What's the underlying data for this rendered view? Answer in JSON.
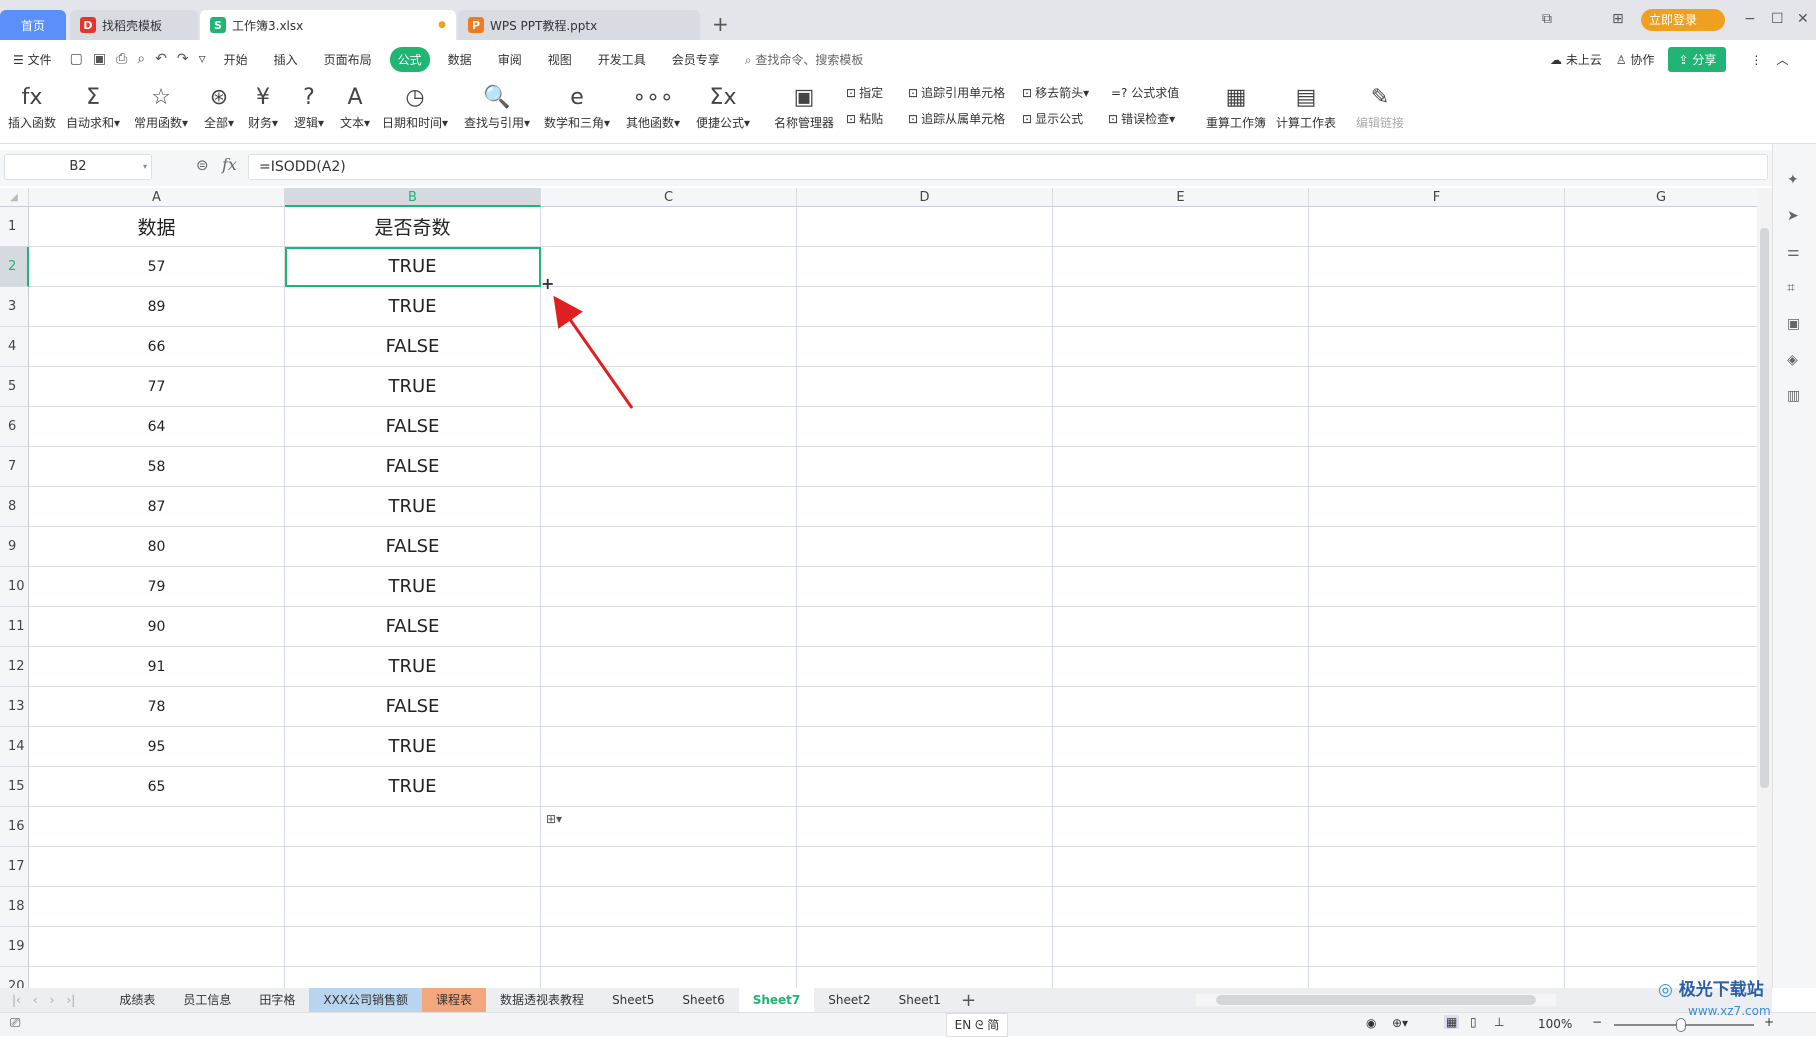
{
  "tabs": [
    {
      "label": "首页",
      "active": false,
      "color": "#5b8ff9"
    },
    {
      "label": "找稻壳模板",
      "icon": "docer-icon",
      "color": "#e8352c"
    },
    {
      "label": "工作簿3.xlsx",
      "icon": "spreadsheet-icon",
      "color": "#21b573",
      "active": true
    },
    {
      "label": "WPS PPT教程.pptx",
      "icon": "presentation-icon",
      "color": "#f07a1f"
    }
  ],
  "login": "立即登录",
  "menu": {
    "file": "文件",
    "items": [
      "开始",
      "插入",
      "页面布局",
      "公式",
      "数据",
      "审阅",
      "视图",
      "开发工具",
      "会员专享"
    ],
    "active": "公式",
    "search": "查找命令、搜索模板",
    "cloud": "未上云",
    "collab": "协作",
    "share": "分享"
  },
  "ribbon": {
    "big": [
      [
        "fx",
        "插入函数"
      ],
      [
        "Σ",
        "自动求和▾"
      ],
      [
        "☆",
        "常用函数▾"
      ],
      [
        "⊛",
        "全部▾"
      ],
      [
        "¥",
        "财务▾"
      ],
      [
        "?",
        "逻辑▾"
      ],
      [
        "A",
        "文本▾"
      ],
      [
        "◷",
        "日期和时间▾"
      ],
      [
        "🔍",
        "查找与引用▾"
      ],
      [
        "e",
        "数学和三角▾"
      ],
      [
        "∘∘∘",
        "其他函数▾"
      ],
      [
        "Σx",
        "便捷公式▾"
      ],
      [
        "▣",
        "名称管理器"
      ]
    ],
    "small": [
      "指定",
      "粘贴",
      "追踪引用单元格",
      "追踪从属单元格",
      "移去箭头▾",
      "显示公式",
      "=? 公式求值",
      "错误检查▾"
    ],
    "big2": [
      [
        "▦",
        "重算工作簿"
      ],
      [
        "▤",
        "计算工作表"
      ],
      [
        "✎",
        "编辑链接"
      ]
    ]
  },
  "formula": {
    "cell": "B2",
    "fx": "fx",
    "value": "=ISODD(A2)"
  },
  "columns": [
    "A",
    "B",
    "C",
    "D",
    "E",
    "F",
    "G"
  ],
  "rows": [
    [
      "数据",
      "是否奇数"
    ],
    [
      "57",
      "TRUE"
    ],
    [
      "89",
      "TRUE"
    ],
    [
      "66",
      "FALSE"
    ],
    [
      "77",
      "TRUE"
    ],
    [
      "64",
      "FALSE"
    ],
    [
      "58",
      "FALSE"
    ],
    [
      "87",
      "TRUE"
    ],
    [
      "80",
      "FALSE"
    ],
    [
      "79",
      "TRUE"
    ],
    [
      "90",
      "FALSE"
    ],
    [
      "91",
      "TRUE"
    ],
    [
      "78",
      "FALSE"
    ],
    [
      "95",
      "TRUE"
    ],
    [
      "65",
      "TRUE"
    ],
    [
      "",
      ""
    ],
    [
      "",
      ""
    ],
    [
      "",
      ""
    ],
    [
      "",
      ""
    ],
    [
      "",
      ""
    ]
  ],
  "sheets": [
    {
      "name": "成绩表"
    },
    {
      "name": "员工信息"
    },
    {
      "name": "田字格"
    },
    {
      "name": "XXX公司销售额",
      "color": "#b8d4ee"
    },
    {
      "name": "课程表",
      "color": "#f4a77c"
    },
    {
      "name": "数据透视表教程"
    },
    {
      "name": "Sheet5"
    },
    {
      "name": "Sheet6"
    },
    {
      "name": "Sheet7",
      "active": true
    },
    {
      "name": "Sheet2"
    },
    {
      "name": "Sheet1"
    }
  ],
  "status": {
    "ime": "EN ᘓ 简",
    "zoom": "100%"
  },
  "watermark": "极光下载站 www.xz7.com",
  "accent": "#21b573"
}
